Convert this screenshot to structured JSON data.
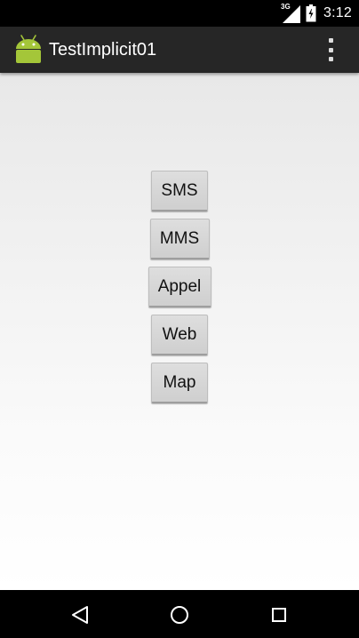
{
  "status_bar": {
    "network_label": "3G",
    "time": "3:12",
    "icons": [
      "signal-icon",
      "battery-icon"
    ]
  },
  "action_bar": {
    "title": "TestImplicit01",
    "icons": [
      "android-app-icon",
      "overflow-menu-icon"
    ]
  },
  "buttons": [
    {
      "label": "SMS"
    },
    {
      "label": "MMS"
    },
    {
      "label": "Appel"
    },
    {
      "label": "Web"
    },
    {
      "label": "Map"
    }
  ],
  "nav_bar": {
    "icons": [
      "back-icon",
      "home-icon",
      "recents-icon"
    ]
  },
  "colors": {
    "action_bar": "#262626",
    "status_bar": "#000000",
    "nav_bar": "#000000",
    "android_green": "#a4c639",
    "button_face": "#d6d6d6"
  }
}
